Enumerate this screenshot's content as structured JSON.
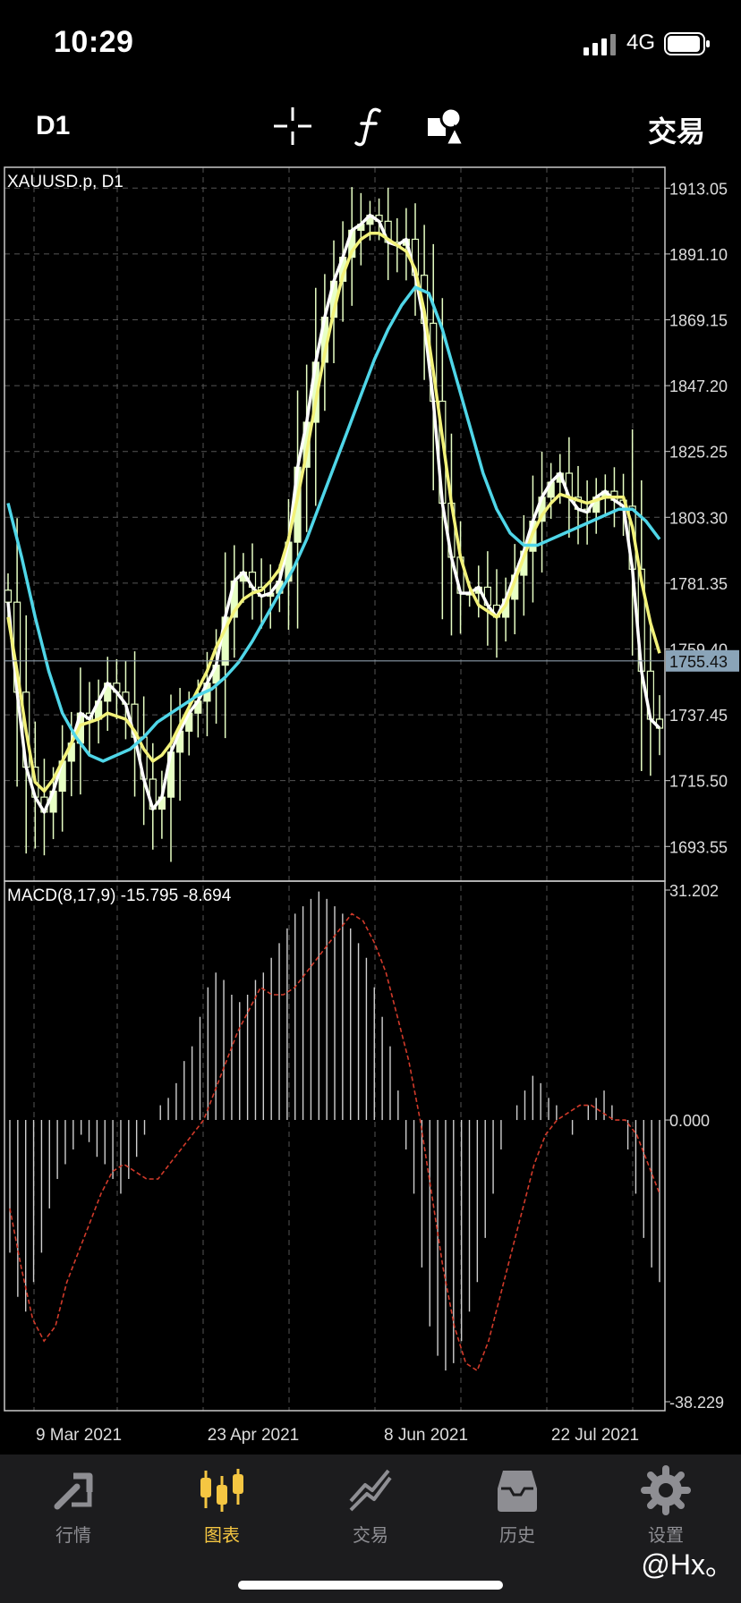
{
  "status": {
    "time": "10:29",
    "network": "4G"
  },
  "toolbar": {
    "period": "D1",
    "icons": [
      "crosshair-icon",
      "function-icon",
      "objects-icon"
    ],
    "trade_label": "交易"
  },
  "chart": {
    "symbol_label": "XAUUSD.p, D1",
    "price_ticks": [
      "1913.05",
      "1891.10",
      "1869.15",
      "1847.20",
      "1825.25",
      "1803.30",
      "1781.35",
      "1759.40",
      "1737.45",
      "1715.50",
      "1693.55"
    ],
    "current_price": "1755.43",
    "macd_label": "MACD(8,17,9) -15.795 -8.694",
    "macd_ticks": [
      "31.202",
      "0.000",
      "-38.229"
    ],
    "date_labels": [
      "9 Mar 2021",
      "23 Apr 2021",
      "8 Jun 2021",
      "22 Jul 2021"
    ],
    "colors": {
      "candles": "#e7ffc4",
      "fast_ma": "#ffffff",
      "slow_ma": "#f2f27a",
      "long_ma": "#4fd6e8",
      "signal_line": "#d13a2a",
      "price_badge": "#8aa4b8"
    }
  },
  "chart_data": [
    {
      "type": "line",
      "title": "XAUUSD.p, D1",
      "xlabel": "",
      "ylabel": "",
      "x_tick_labels": [
        "9 Mar 2021",
        "23 Apr 2021",
        "8 Jun 2021",
        "22 Jul 2021"
      ],
      "ylim": [
        1682,
        1920
      ],
      "series": [
        {
          "name": "",
          "values": [
            1775,
            1745,
            1720,
            1710,
            1705,
            1712,
            1722,
            1728,
            1738,
            1736,
            1742,
            1748,
            1745,
            1741,
            1730,
            1716,
            1706,
            1710,
            1725,
            1732,
            1738,
            1742,
            1748,
            1754,
            1770,
            1782,
            1785,
            1780,
            1777,
            1778,
            1782,
            1795,
            1820,
            1835,
            1855,
            1870,
            1882,
            1890,
            1899,
            1901,
            1904,
            1902,
            1895,
            1894,
            1896,
            1884,
            1868,
            1842,
            1808,
            1790,
            1778,
            1778,
            1780,
            1774,
            1770,
            1776,
            1784,
            1792,
            1802,
            1810,
            1815,
            1818,
            1810,
            1806,
            1805,
            1810,
            1812,
            1809,
            1807,
            1786,
            1752,
            1736,
            1733
          ]
        },
        {
          "name": "",
          "values": [
            1770,
            1752,
            1732,
            1715,
            1712,
            1716,
            1722,
            1728,
            1734,
            1735,
            1736,
            1738,
            1737,
            1736,
            1732,
            1726,
            1722,
            1724,
            1728,
            1734,
            1740,
            1746,
            1752,
            1760,
            1766,
            1772,
            1776,
            1778,
            1779,
            1782,
            1786,
            1796,
            1810,
            1825,
            1842,
            1858,
            1872,
            1884,
            1892,
            1896,
            1898,
            1898,
            1896,
            1894,
            1892,
            1886,
            1872,
            1852,
            1830,
            1808,
            1790,
            1780,
            1774,
            1772,
            1770,
            1774,
            1782,
            1790,
            1798,
            1804,
            1808,
            1811,
            1810,
            1809,
            1808,
            1809,
            1810,
            1810,
            1810,
            1800,
            1782,
            1768,
            1758
          ]
        },
        {
          "name": "",
          "values": [
            1808,
            1790,
            1770,
            1752,
            1738,
            1730,
            1724,
            1722,
            1724,
            1726,
            1730,
            1735,
            1738,
            1741,
            1744,
            1746,
            1750,
            1755,
            1762,
            1770,
            1778,
            1786,
            1796,
            1808,
            1820,
            1832,
            1844,
            1856,
            1866,
            1874,
            1880,
            1878,
            1866,
            1850,
            1834,
            1818,
            1806,
            1798,
            1794,
            1794,
            1796,
            1798,
            1800,
            1802,
            1804,
            1806,
            1806,
            1802,
            1796
          ]
        }
      ]
    },
    {
      "type": "bar",
      "title": "MACD(8,17,9) -15.795 -8.694",
      "ylim": [
        -38.229,
        31.202
      ],
      "series": [
        {
          "name": "",
          "values": [
            -18,
            -24,
            -26,
            -22,
            -18,
            -12,
            -8,
            -6,
            -4,
            -2,
            -3,
            -5,
            -6,
            -8,
            -10,
            -8,
            -5,
            -2,
            0,
            2,
            3,
            5,
            8,
            10,
            14,
            18,
            20,
            19,
            17,
            16,
            17,
            19,
            20,
            22,
            24,
            26,
            28,
            29,
            30,
            31,
            30,
            29,
            28,
            26,
            24,
            22,
            18,
            14,
            10,
            4,
            -4,
            -10,
            -20,
            -28,
            -32,
            -34,
            -33,
            -30,
            -26,
            -22,
            -16,
            -10,
            -4,
            0,
            2,
            4,
            6,
            5,
            3,
            2,
            0,
            -2,
            0,
            2,
            3,
            4,
            2,
            0,
            -4,
            -10,
            -16,
            -20,
            -22
          ]
        },
        {
          "name": "",
          "values": [
            -12,
            -20,
            -27,
            -30,
            -28,
            -22,
            -18,
            -14,
            -10,
            -7,
            -6,
            -7,
            -8,
            -8,
            -6,
            -4,
            -2,
            0,
            4,
            8,
            12,
            15,
            18,
            17,
            17,
            18,
            20,
            22,
            24,
            26,
            28,
            27,
            24,
            20,
            14,
            8,
            0,
            -10,
            -20,
            -28,
            -33,
            -34,
            -30,
            -24,
            -18,
            -12,
            -6,
            -2,
            0,
            1,
            2,
            2,
            1,
            0,
            0,
            -2,
            -6,
            -10
          ]
        }
      ]
    }
  ],
  "tabs": [
    {
      "label": "行情",
      "icon": "quotes-icon",
      "active": false
    },
    {
      "label": "图表",
      "icon": "chart-icon",
      "active": true
    },
    {
      "label": "交易",
      "icon": "trade-icon",
      "active": false
    },
    {
      "label": "历史",
      "icon": "history-icon",
      "active": false
    },
    {
      "label": "设置",
      "icon": "settings-icon",
      "active": false
    }
  ],
  "watermark": "@Hx。"
}
